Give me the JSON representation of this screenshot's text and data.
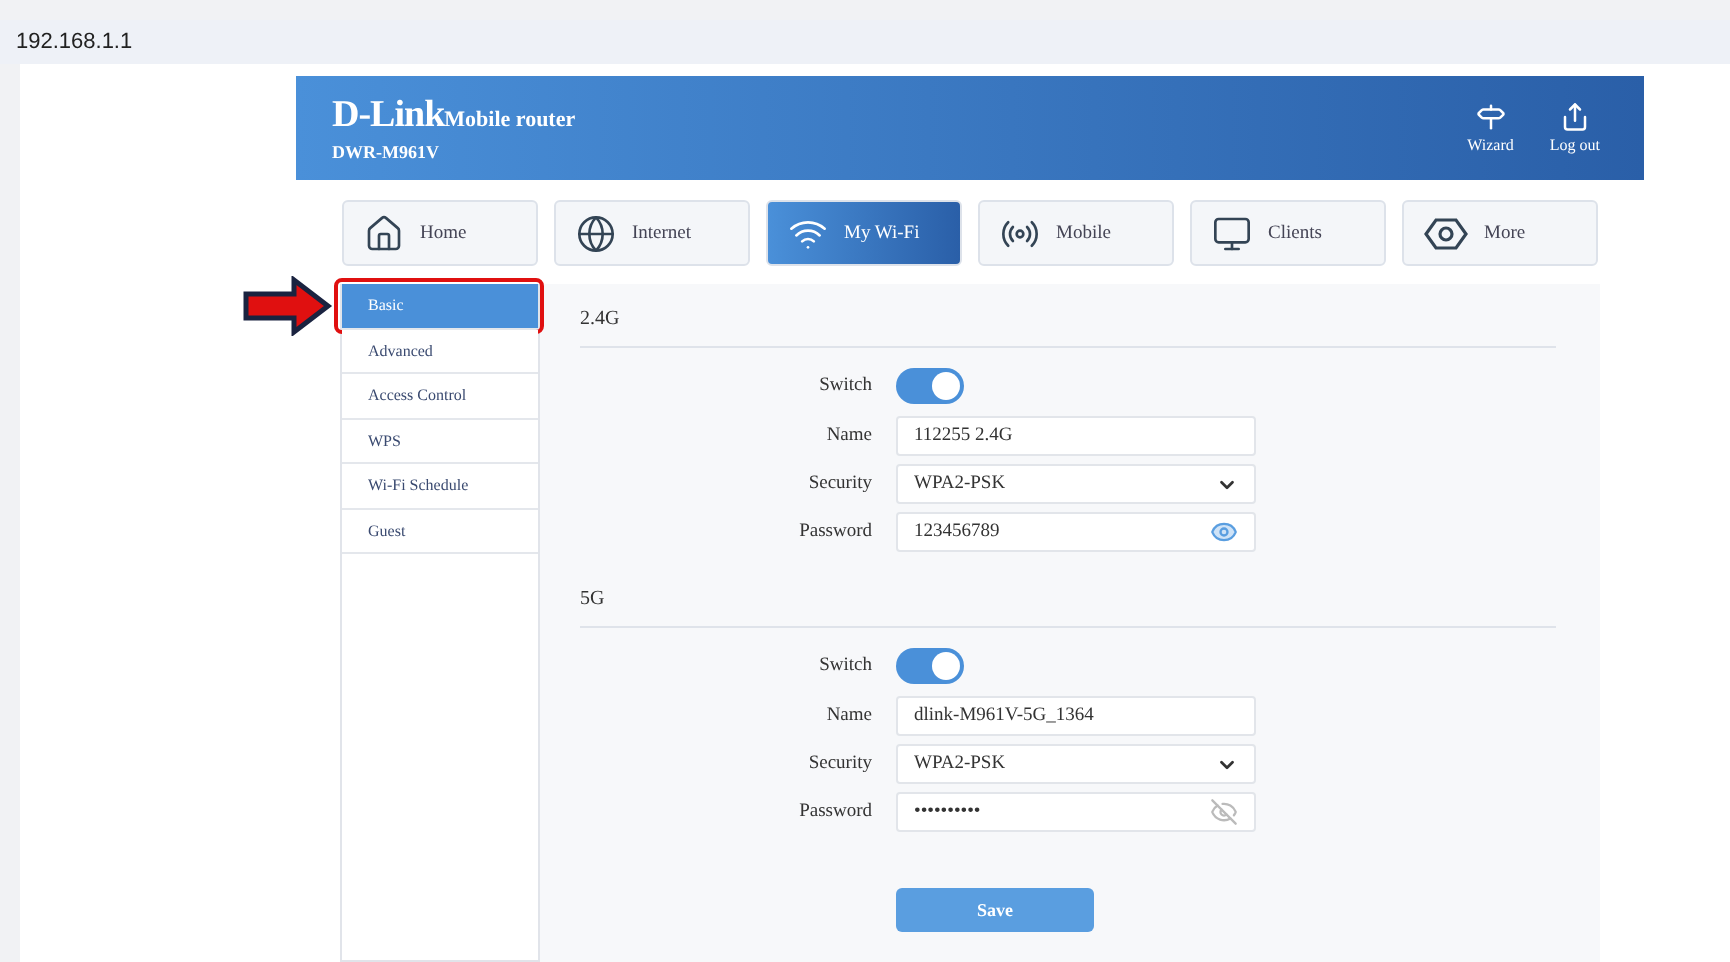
{
  "address_bar": {
    "url": "192.168.1.1"
  },
  "header": {
    "logo": "D-Link",
    "product": "Mobile router",
    "model": "DWR-M961V",
    "actions": [
      {
        "kind": "wizard",
        "label": "Wizard"
      },
      {
        "kind": "logout",
        "label": "Log out"
      }
    ]
  },
  "tabs": [
    {
      "kind": "home",
      "label": "Home",
      "selected": false
    },
    {
      "kind": "internet",
      "label": "Internet",
      "selected": false
    },
    {
      "kind": "wifi",
      "label": "My Wi-Fi",
      "selected": true
    },
    {
      "kind": "mobile",
      "label": "Mobile",
      "selected": false
    },
    {
      "kind": "clients",
      "label": "Clients",
      "selected": false
    },
    {
      "kind": "more",
      "label": "More",
      "selected": false
    }
  ],
  "sidebar": {
    "items": [
      {
        "label": "Basic",
        "selected": true,
        "annotated": true
      },
      {
        "label": "Advanced",
        "selected": false,
        "annotated": false
      },
      {
        "label": "Access Control",
        "selected": false,
        "annotated": false
      },
      {
        "label": "WPS",
        "selected": false,
        "annotated": false
      },
      {
        "label": "Wi-Fi Schedule",
        "selected": false,
        "annotated": false
      },
      {
        "label": "Guest",
        "selected": false,
        "annotated": false
      }
    ]
  },
  "sections": [
    {
      "title": "2.4G",
      "fields": [
        {
          "kind": "switch",
          "label": "Switch",
          "on": true
        },
        {
          "kind": "text",
          "label": "Name",
          "value": "112255 2.4G"
        },
        {
          "kind": "select",
          "label": "Security",
          "value": "WPA2-PSK"
        },
        {
          "kind": "password",
          "label": "Password",
          "value": "123456789",
          "visible": true
        }
      ]
    },
    {
      "title": "5G",
      "fields": [
        {
          "kind": "switch",
          "label": "Switch",
          "on": true
        },
        {
          "kind": "text",
          "label": "Name",
          "value": "dlink-M961V-5G_1364"
        },
        {
          "kind": "select",
          "label": "Security",
          "value": "WPA2-PSK"
        },
        {
          "kind": "password",
          "label": "Password",
          "value": "••••••••••",
          "visible": false
        }
      ]
    }
  ],
  "save_button": "Save"
}
